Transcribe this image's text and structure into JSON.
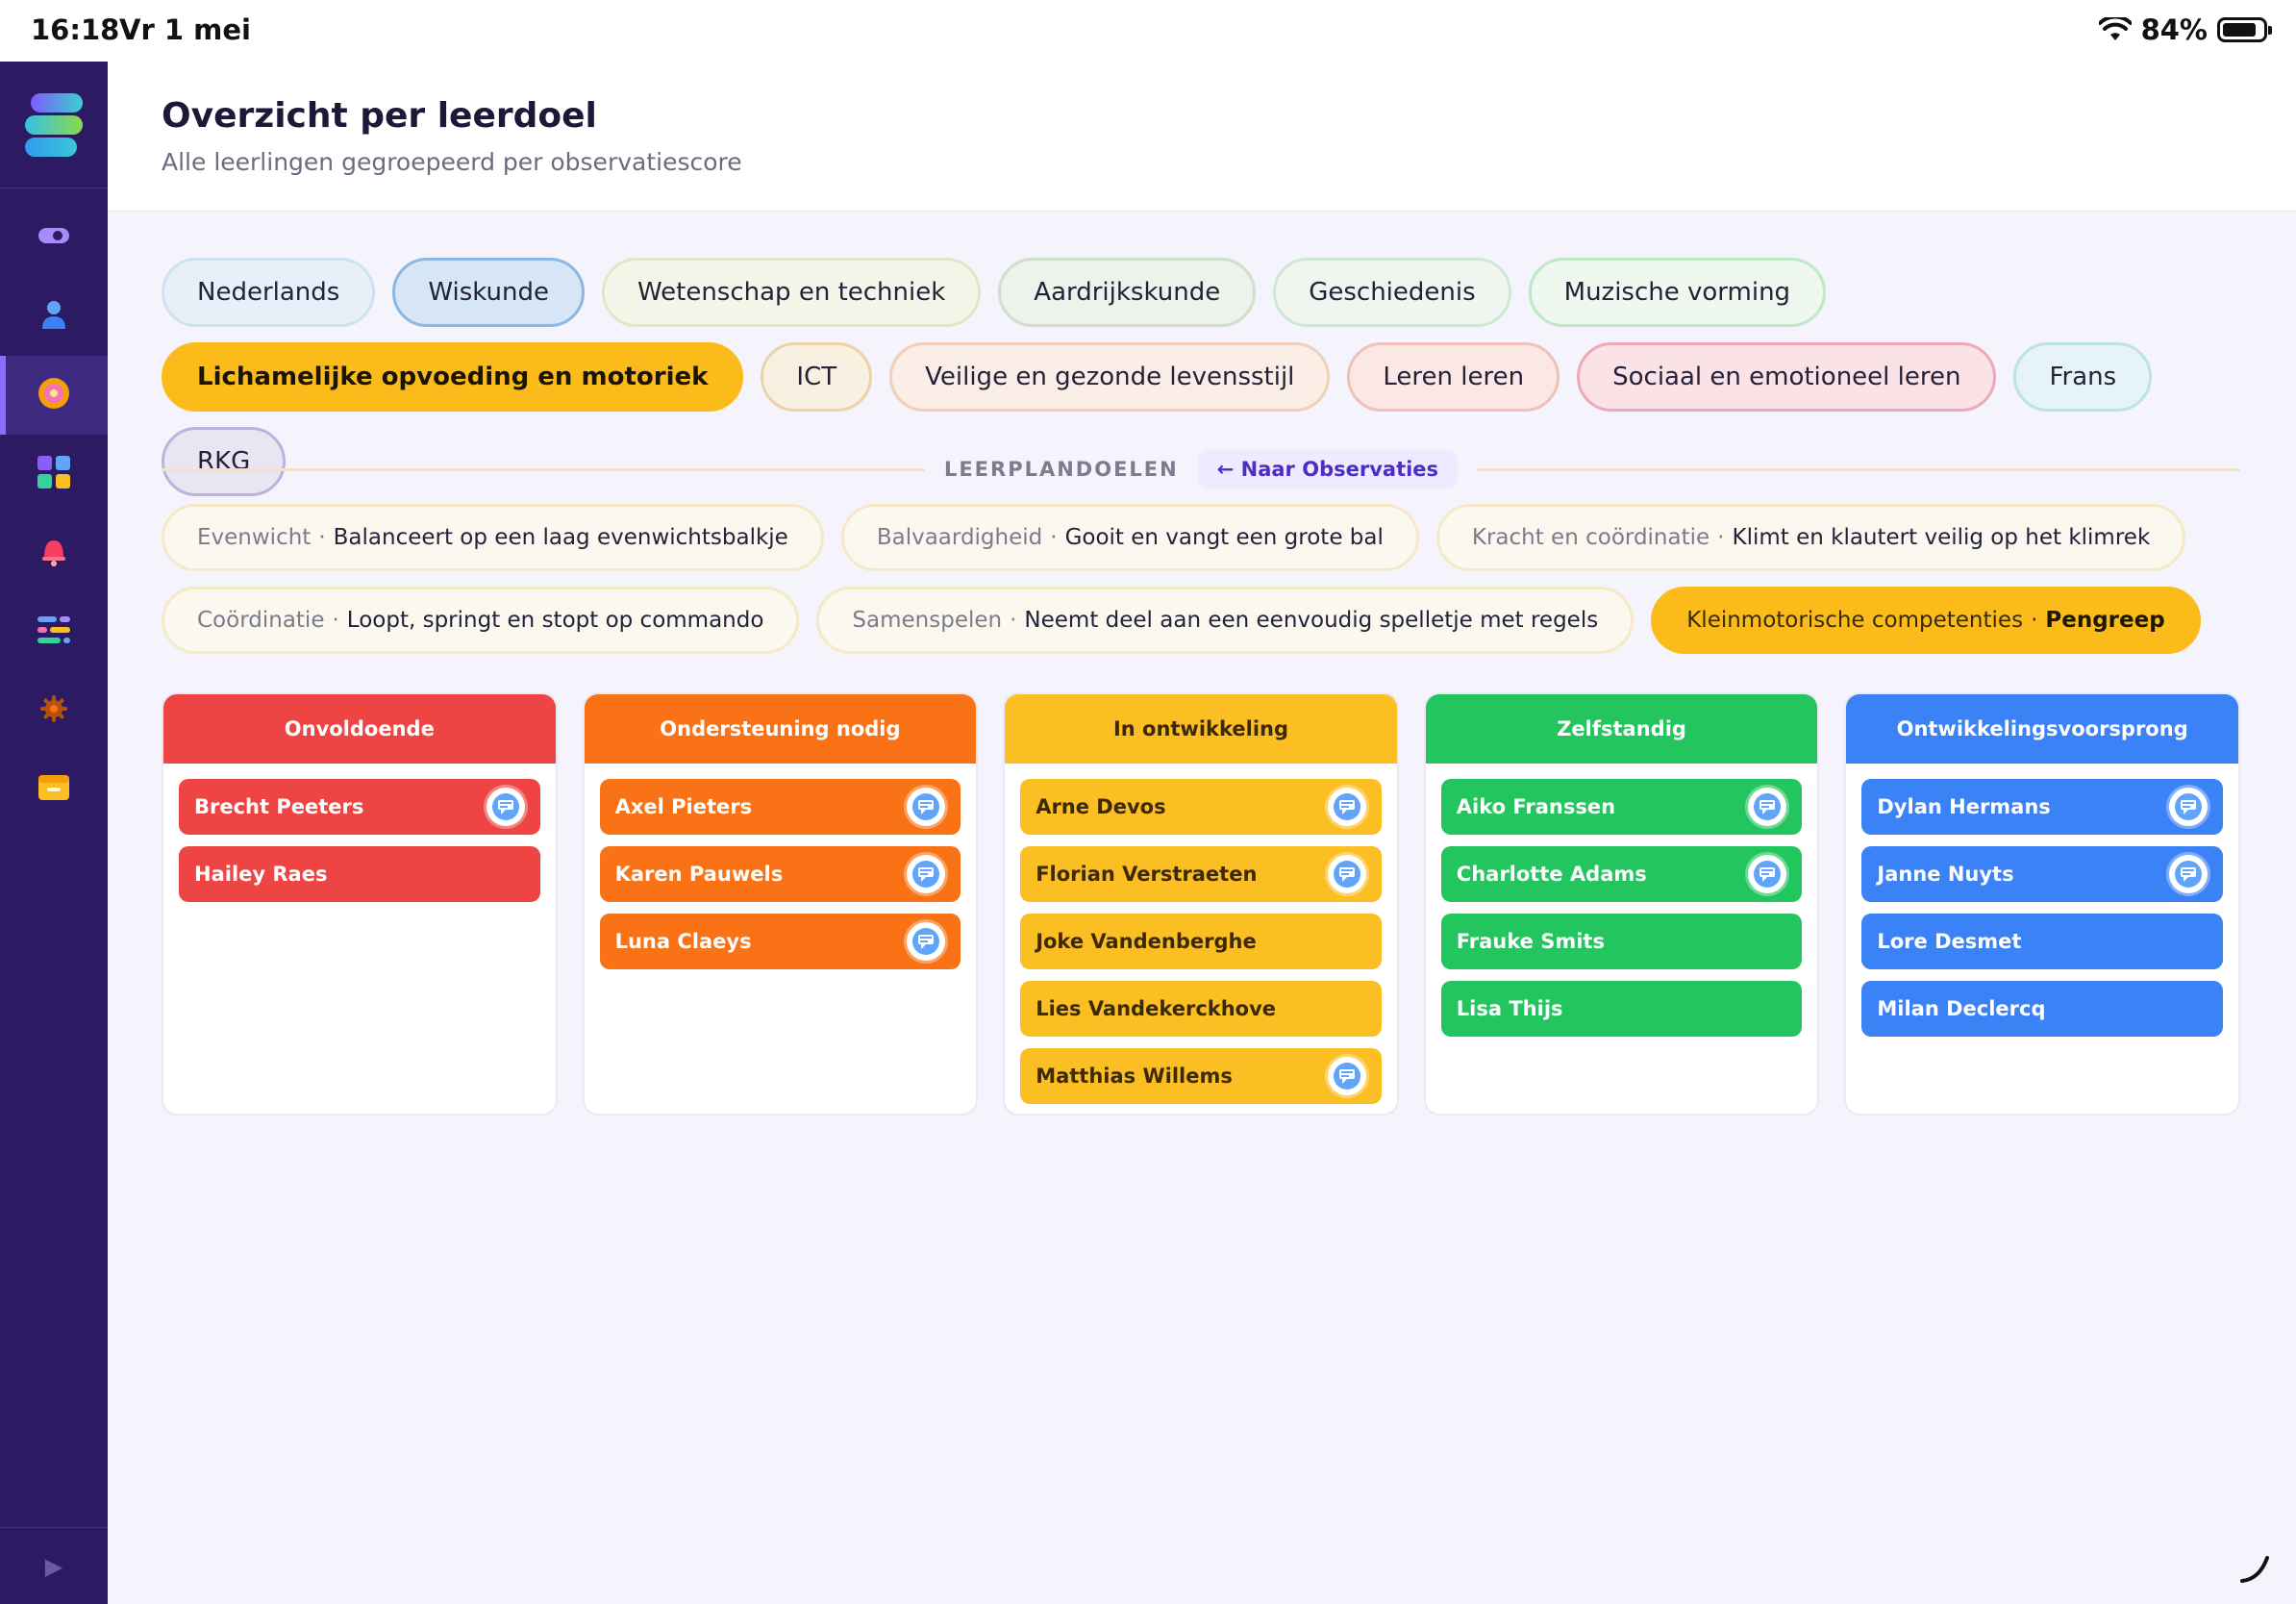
{
  "status_bar": {
    "time": "16:18",
    "date": "Vr 1 mei",
    "battery": "84%",
    "battery_level": 0.84
  },
  "header": {
    "title": "Overzicht per leerdoel",
    "subtitle": "Alle leerlingen gegroepeerd per observatiescore"
  },
  "subjects": [
    {
      "label": "Nederlands",
      "bg": "#e6f0f8",
      "border": "#cfe1ef",
      "active": false
    },
    {
      "label": "Wiskunde",
      "bg": "#d6e6f7",
      "border": "#8db7e3",
      "active": false
    },
    {
      "label": "Wetenschap en techniek",
      "bg": "#f5f6e9",
      "border": "#e0e7c3",
      "active": false
    },
    {
      "label": "Aardrijkskunde",
      "bg": "#edf2ea",
      "border": "#cfe0cb",
      "active": false
    },
    {
      "label": "Geschiedenis",
      "bg": "#eef6ef",
      "border": "#cfe8d3",
      "active": false
    },
    {
      "label": "Muzische vorming",
      "bg": "#eef8ef",
      "border": "#bfe8c6",
      "active": false
    },
    {
      "label": "Lichamelijke opvoeding en motoriek",
      "bg": "#fbbc1b",
      "border": "#fbbc1b",
      "active": true
    },
    {
      "label": "ICT",
      "bg": "#f9f0e1",
      "border": "#ecd3a7",
      "active": false
    },
    {
      "label": "Veilige en gezonde levensstijl",
      "bg": "#fbeee6",
      "border": "#f1d0bb",
      "active": false
    },
    {
      "label": "Leren leren",
      "bg": "#fbe7e4",
      "border": "#f1c0b7",
      "active": false
    },
    {
      "label": "Sociaal en emotioneel leren",
      "bg": "#fbe2e6",
      "border": "#efa8b5",
      "active": false
    },
    {
      "label": "Frans",
      "bg": "#e6f4f8",
      "border": "#bfe1ec",
      "active": false
    },
    {
      "label": "RKG",
      "bg": "#e8e6f3",
      "border": "#b9b4dc",
      "active": false
    }
  ],
  "goals_section": {
    "label": "LEERPLANDOELEN",
    "back_button": "← Naar Observaties"
  },
  "goals": [
    {
      "category": "Evenwicht",
      "name": "Balanceert op een laag evenwichtsbalkje",
      "active": false
    },
    {
      "category": "Balvaardigheid",
      "name": "Gooit en vangt een grote bal",
      "active": false
    },
    {
      "category": "Kracht en coördinatie",
      "name": "Klimt en klautert veilig op het klimrek",
      "active": false
    },
    {
      "category": "Coördinatie",
      "name": "Loopt, springt en stopt op commando",
      "active": false
    },
    {
      "category": "Samenspelen",
      "name": "Neemt deel aan een eenvoudig spelletje met regels",
      "active": false
    },
    {
      "category": "Kleinmotorische competenties",
      "name": "Pengreep",
      "active": true
    }
  ],
  "goal_separator": "·",
  "columns": [
    {
      "title": "Onvoldoende",
      "color": "#ef4444",
      "text_dark": false,
      "students": [
        {
          "name": "Brecht Peeters",
          "has_note": true
        },
        {
          "name": "Hailey Raes",
          "has_note": false
        }
      ]
    },
    {
      "title": "Ondersteuning nodig",
      "color": "#f97316",
      "text_dark": false,
      "students": [
        {
          "name": "Axel Pieters",
          "has_note": true
        },
        {
          "name": "Karen Pauwels",
          "has_note": true
        },
        {
          "name": "Luna Claeys",
          "has_note": true
        }
      ]
    },
    {
      "title": "In ontwikkeling",
      "color": "#fbbf24",
      "text_dark": true,
      "students": [
        {
          "name": "Arne Devos",
          "has_note": true
        },
        {
          "name": "Florian Verstraeten",
          "has_note": true
        },
        {
          "name": "Joke Vandenberghe",
          "has_note": false
        },
        {
          "name": "Lies Vandekerckhove",
          "has_note": false
        },
        {
          "name": "Matthias Willems",
          "has_note": true
        }
      ]
    },
    {
      "title": "Zelfstandig",
      "color": "#22c55e",
      "text_dark": false,
      "students": [
        {
          "name": "Aiko Franssen",
          "has_note": true
        },
        {
          "name": "Charlotte Adams",
          "has_note": true
        },
        {
          "name": "Frauke Smits",
          "has_note": false
        },
        {
          "name": "Lisa Thijs",
          "has_note": false
        }
      ]
    },
    {
      "title": "Ontwikkelingsvoorsprong",
      "color": "#3b82f6",
      "text_dark": false,
      "students": [
        {
          "name": "Dylan Hermans",
          "has_note": true
        },
        {
          "name": "Janne Nuyts",
          "has_note": true
        },
        {
          "name": "Lore Desmet",
          "has_note": false
        },
        {
          "name": "Milan Declercq",
          "has_note": false
        }
      ]
    }
  ],
  "sidebar": {
    "items": [
      {
        "icon": "toggle-icon",
        "active": false
      },
      {
        "icon": "user-icon",
        "active": false
      },
      {
        "icon": "target-icon",
        "active": true
      },
      {
        "icon": "grid-icon",
        "active": false
      },
      {
        "icon": "bell-icon",
        "active": false
      },
      {
        "icon": "sliders-icon",
        "active": false
      },
      {
        "icon": "gear-icon",
        "active": false
      },
      {
        "icon": "archive-icon",
        "active": false
      }
    ],
    "expand_icon": "play-icon"
  }
}
